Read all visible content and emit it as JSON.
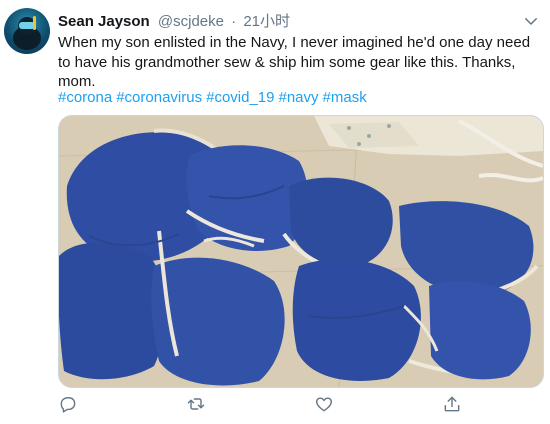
{
  "tweet": {
    "author_name": "Sean Jayson",
    "author_handle": "@scjdeke",
    "separator": "·",
    "time": "21小时",
    "text": "When my son enlisted in the Navy, I never imagined he'd one day need to have his grandmother sew & ship him some gear like this. Thanks, mom.",
    "hashtags": [
      "#corona",
      "#coronavirus",
      "#covid_19",
      "#navy",
      "#mask"
    ]
  },
  "icons": {
    "caret": "chevron-down-icon",
    "reply": "reply-icon",
    "retweet": "retweet-icon",
    "like": "like-icon",
    "share": "share-icon"
  },
  "colors": {
    "link": "#1da1f2",
    "secondary_text": "#657786",
    "mask_blue": "#2f4ea3"
  }
}
